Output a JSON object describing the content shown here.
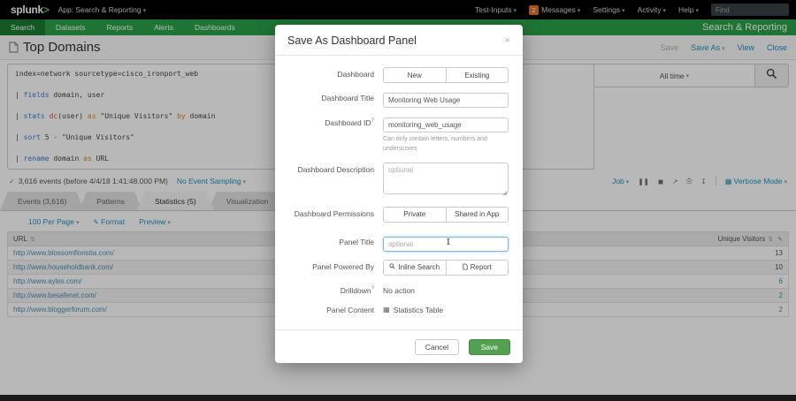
{
  "colors": {
    "nav_green": "#2aa148",
    "active_nav_green": "#1c7a33",
    "link_blue": "#1e93c6",
    "badge_orange": "#e1731e",
    "save_green": "#53a051"
  },
  "icons": {
    "caret": "▾",
    "check": "✓",
    "close": "×",
    "sort": "⇅",
    "pencil": "✎",
    "pause": "❚❚",
    "stop": "◼",
    "share": "↗",
    "print": "⎙",
    "export": "↧",
    "grid": "▦",
    "resize": "◢",
    "ibeam": "I"
  },
  "topbar": {
    "logo": "splunk",
    "logo_gt": ">",
    "app_label": "App: Search & Reporting",
    "test_inputs": "Test-Inputs",
    "badge_count": "2",
    "messages": "Messages",
    "settings": "Settings",
    "activity": "Activity",
    "help": "Help",
    "find_placeholder": "Find"
  },
  "navbar": {
    "items": [
      {
        "label": "Search"
      },
      {
        "label": "Datasets"
      },
      {
        "label": "Reports"
      },
      {
        "label": "Alerts"
      },
      {
        "label": "Dashboards"
      }
    ],
    "app_name": "Search & Reporting"
  },
  "report_header": {
    "title": "Top Domains",
    "save": "Save",
    "save_as": "Save As",
    "view": "View",
    "close": "Close"
  },
  "search": {
    "time_range": "All time",
    "query": {
      "line1": "index=network sourcetype=cisco_ironport_web",
      "pipe": "| ",
      "l2_cmd": "fields",
      "l2_rest": " domain, user",
      "l3_cmd": "stats",
      "l3_sp": " ",
      "l3_fn": "dc",
      "l3_p1": "(user) ",
      "l3_as": "as",
      "l3_p2": " \"Unique Visitors\" ",
      "l3_by": "by",
      "l3_p3": " domain",
      "l4_cmd": "sort",
      "l4_rest": " 5 - \"Unique Visitors\"",
      "l5_cmd": "rename",
      "l5_p1": " domain ",
      "l5_as": "as",
      "l5_p2": " URL"
    }
  },
  "events_bar": {
    "summary": "3,616 events (before 4/4/18 1:41:48.000 PM)",
    "sampling": "No Event Sampling"
  },
  "job_bar": {
    "job": "Job",
    "mode": "Verbose Mode"
  },
  "tabs": [
    {
      "label": "Events (3,616)"
    },
    {
      "label": "Patterns"
    },
    {
      "label": "Statistics (5)"
    },
    {
      "label": "Visualization"
    }
  ],
  "results_toolbar": {
    "per_page": "100 Per Page",
    "format": "Format",
    "preview": "Preview"
  },
  "table": {
    "headers": {
      "url": "URL",
      "visitors": "Unique Visitors"
    },
    "rows": [
      {
        "url": "http://www.blossomfloristla.com/",
        "visitors": "13"
      },
      {
        "url": "http://www.householdbank.com/",
        "visitors": "10"
      },
      {
        "url": "http://www.ayles.com/",
        "visitors": "6"
      },
      {
        "url": "http://www.besafenet.com/",
        "visitors": "2"
      },
      {
        "url": "http://www.bloggerforum.com/",
        "visitors": "2"
      }
    ]
  },
  "modal": {
    "title": "Save As Dashboard Panel",
    "fields": {
      "dashboard_label": "Dashboard",
      "new": "New",
      "existing": "Existing",
      "title_label": "Dashboard Title",
      "title_value": "Monitoring Web Usage",
      "id_label": "Dashboard ID",
      "id_sup": "?",
      "id_value": "monitoring_web_usage",
      "id_help_1": "Can only contain letters, numbers and",
      "id_help_2": "underscores",
      "desc_label": "Dashboard Description",
      "desc_placeholder": "optional",
      "perm_label": "Dashboard Permissions",
      "private": "Private",
      "shared": "Shared in App",
      "panel_title_label": "Panel Title",
      "panel_title_placeholder": "optional",
      "powered_label": "Panel Powered By",
      "inline_search": "Inline Search",
      "report": "Report",
      "drilldown_label": "Drilldown",
      "drilldown_sup": "?",
      "drilldown_value": "No action",
      "content_label": "Panel Content",
      "content_value": "Statistics Table"
    },
    "cancel": "Cancel",
    "save": "Save"
  }
}
